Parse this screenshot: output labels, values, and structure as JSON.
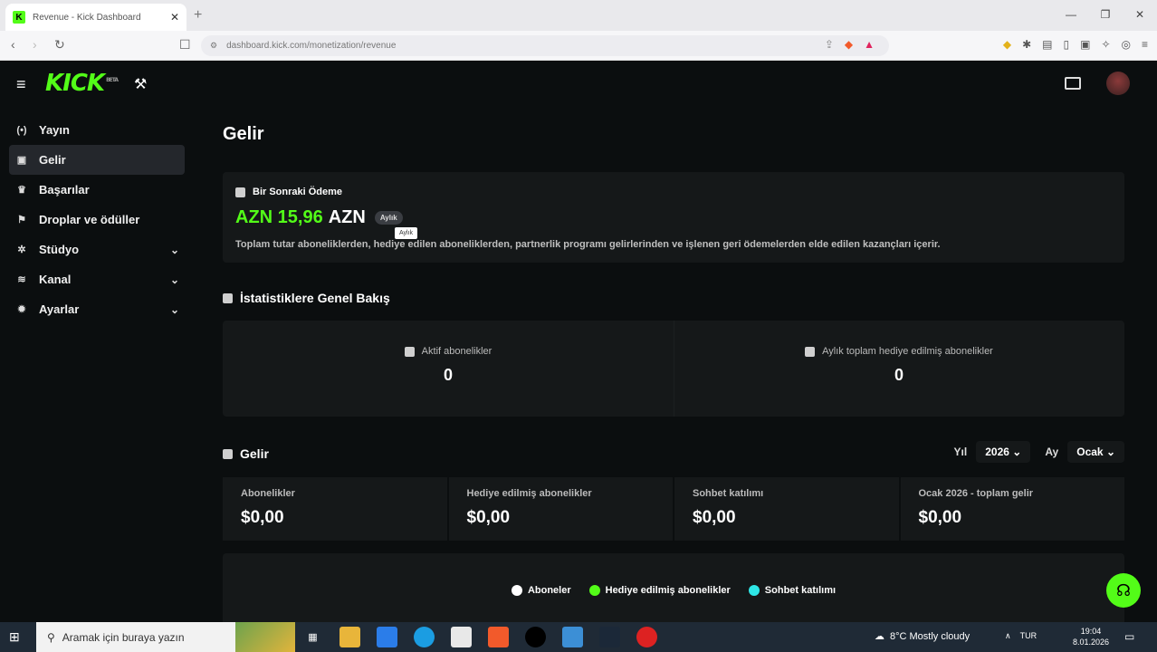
{
  "browser": {
    "tab_title": "Revenue - Kick Dashboard",
    "url": "dashboard.kick.com/monetization/revenue"
  },
  "app": {
    "logo_text": "KICK",
    "logo_sup": "BETA",
    "brand_color": "#53fc18"
  },
  "sidebar": {
    "items": [
      {
        "label": "Yayın",
        "icon": "broadcast-icon",
        "active": false,
        "expandable": false
      },
      {
        "label": "Gelir",
        "icon": "revenue-icon",
        "active": true,
        "expandable": false
      },
      {
        "label": "Başarılar",
        "icon": "trophy-icon",
        "active": false,
        "expandable": false
      },
      {
        "label": "Droplar ve ödüller",
        "icon": "gift-icon",
        "active": false,
        "expandable": false
      },
      {
        "label": "Stüdyo",
        "icon": "studio-icon",
        "active": false,
        "expandable": true
      },
      {
        "label": "Kanal",
        "icon": "channel-icon",
        "active": false,
        "expandable": true
      },
      {
        "label": "Ayarlar",
        "icon": "gear-icon",
        "active": false,
        "expandable": true
      }
    ]
  },
  "main": {
    "page_title": "Gelir",
    "payout": {
      "heading": "Bir Sonraki Ödeme",
      "amount": "AZN 15,96",
      "currency": "AZN",
      "badge": "Aylık",
      "tooltip": "Aylık",
      "description": "Toplam tutar aboneliklerden, hediye edilen aboneliklerden, partnerlik programı gelirlerinden ve işlenen geri ödemelerden elde edilen kazançları içerir."
    },
    "stats": {
      "heading": "İstatistiklere Genel Bakış",
      "items": [
        {
          "label": "Aktif abonelikler",
          "value": "0"
        },
        {
          "label": "Aylık toplam hediye edilmiş abonelikler",
          "value": "0"
        }
      ]
    },
    "revenue": {
      "heading": "Gelir",
      "year_label": "Yıl",
      "year_value": "2026",
      "month_label": "Ay",
      "month_value": "Ocak",
      "cards": [
        {
          "label": "Abonelikler",
          "value": "$0,00"
        },
        {
          "label": "Hediye edilmiş abonelikler",
          "value": "$0,00"
        },
        {
          "label": "Sohbet katılımı",
          "value": "$0,00"
        },
        {
          "label": "Ocak 2026 - toplam gelir",
          "value": "$0,00"
        }
      ],
      "legend": [
        {
          "label": "Aboneler",
          "color": "#ffffff"
        },
        {
          "label": "Hediye edilmiş abonelikler",
          "color": "#53fc18"
        },
        {
          "label": "Sohbet katılımı",
          "color": "#2ee6e6"
        }
      ]
    }
  },
  "taskbar": {
    "search_placeholder": "Aramak için buraya yazın",
    "weather": "8°C  Mostly cloudy",
    "lang": "TUR",
    "time": "19:04",
    "date": "8.01.2026"
  }
}
